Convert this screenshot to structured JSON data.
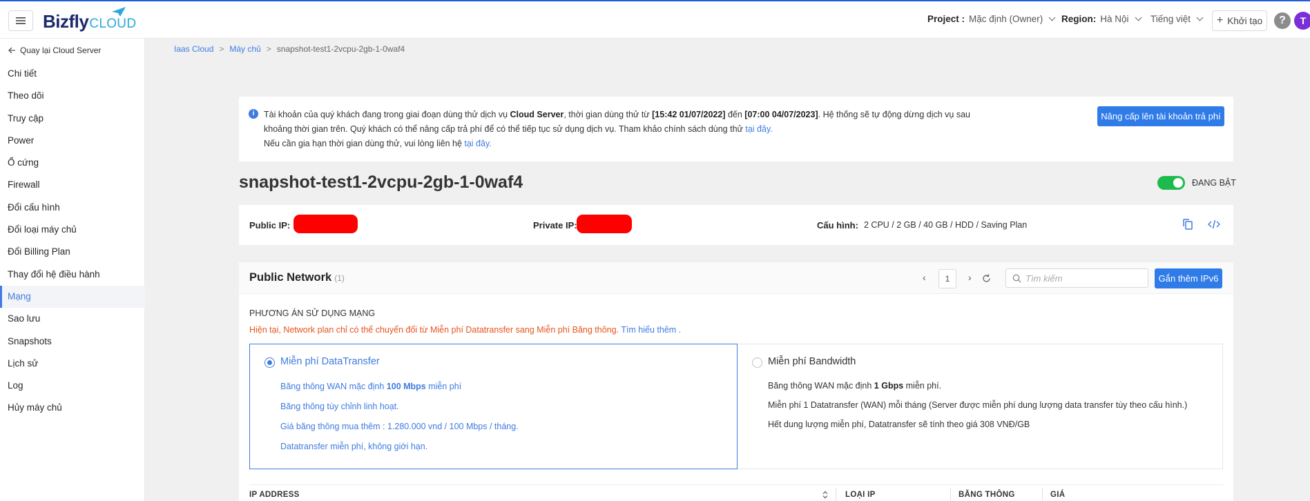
{
  "header": {
    "logo_main": "Bizfly",
    "logo_sub": "CLOUD",
    "project_label": "Project :",
    "project_value": "Mặc định (Owner)",
    "region_label": "Region:",
    "region_value": "Hà Nội",
    "language": "Tiếng việt",
    "create_label": "Khởi tạo",
    "help": "?",
    "avatar_initial": "T"
  },
  "sidebar": {
    "back_label": "Quay lại Cloud Server",
    "items": [
      {
        "label": "Chi tiết"
      },
      {
        "label": "Theo dõi"
      },
      {
        "label": "Truy cập"
      },
      {
        "label": "Power"
      },
      {
        "label": "Ổ cứng"
      },
      {
        "label": "Firewall"
      },
      {
        "label": "Đổi cấu hình"
      },
      {
        "label": "Đổi loại máy chủ"
      },
      {
        "label": "Đổi Billing Plan"
      },
      {
        "label": "Thay đổi hệ điều hành"
      },
      {
        "label": "Mạng",
        "active": true
      },
      {
        "label": "Sao lưu"
      },
      {
        "label": "Snapshots"
      },
      {
        "label": "Lịch sử"
      },
      {
        "label": "Log"
      },
      {
        "label": "Hủy máy chủ"
      }
    ]
  },
  "breadcrumb": [
    "Iaas Cloud",
    "Máy chủ",
    "snapshot-test1-2vcpu-2gb-1-0waf4"
  ],
  "notice": {
    "p1_a": "Tài khoản của quý khách đang trong giai đoạn dùng thử dịch vụ ",
    "p1_service": "Cloud Server",
    "p1_b": ", thời gian dùng thử từ ",
    "p1_from": "[15:42 01/07/2022]",
    "p1_c": " đến ",
    "p1_to": "[07:00 04/07/2023]",
    "p1_d": ". Hệ thống sẽ tự động dừng dịch vụ sau khoảng thời gian trên. Quý khách có thể nâng cấp trả phí để có thể tiếp tục sử dụng dịch vụ. Tham khảo chính sách dùng thử ",
    "p1_link": "tại đây.",
    "p2": "Nếu cần gia hạn thời gian dùng thử, vui lòng liên hệ ",
    "p2_link": "tại đây.",
    "upgrade_button": "Nâng cấp lên tài khoản trả phí"
  },
  "server": {
    "name": "snapshot-test1-2vcpu-2gb-1-0waf4",
    "status": "ĐANG BẬT",
    "public_ip_label": "Public IP:",
    "private_ip_label": "Private IP:",
    "config_label": "Cấu hình:",
    "config_value": "2 CPU / 2 GB / 40 GB / HDD / Saving Plan"
  },
  "network": {
    "title": "Public Network",
    "count": "(1)",
    "page": "1",
    "search_placeholder": "Tìm kiếm",
    "add_ipv6": "Gắn thêm IPv6",
    "plan_title": "PHƯƠNG ÁN SỬ DỤNG MẠNG",
    "plan_note": "Hiện tại, Network plan chỉ có thể chuyển đổi từ Miễn phí Datatransfer sang Miễn phí Băng thông.",
    "plan_note_link": "Tìm hiểu thêm .",
    "plan_a": {
      "title": "Miễn phí DataTransfer",
      "l1_a": "Băng thông WAN mặc định ",
      "l1_b": "100 Mbps",
      "l1_c": " miễn phí",
      "l2": "Băng thông tùy chỉnh linh hoạt.",
      "l3": "Giá băng thông mua thêm : 1.280.000 vnd / 100 Mbps / tháng.",
      "l4": "Datatransfer miễn phí, không giới hạn."
    },
    "plan_b": {
      "title": "Miễn phí Bandwidth",
      "l1_a": "Băng thông WAN mặc định ",
      "l1_b": "1 Gbps",
      "l1_c": " miễn phí.",
      "l2": "Miễn phí 1 Datatransfer (WAN) mỗi tháng (Server được miễn phí dung lượng data transfer tùy theo cấu hình.)",
      "l3": "Hết dung lượng miễn phí, Datatransfer sẽ tính theo giá 308 VNĐ/GB"
    },
    "columns": [
      "IP ADDRESS",
      "LOẠI IP",
      "BĂNG THÔNG",
      "GIÁ"
    ]
  }
}
